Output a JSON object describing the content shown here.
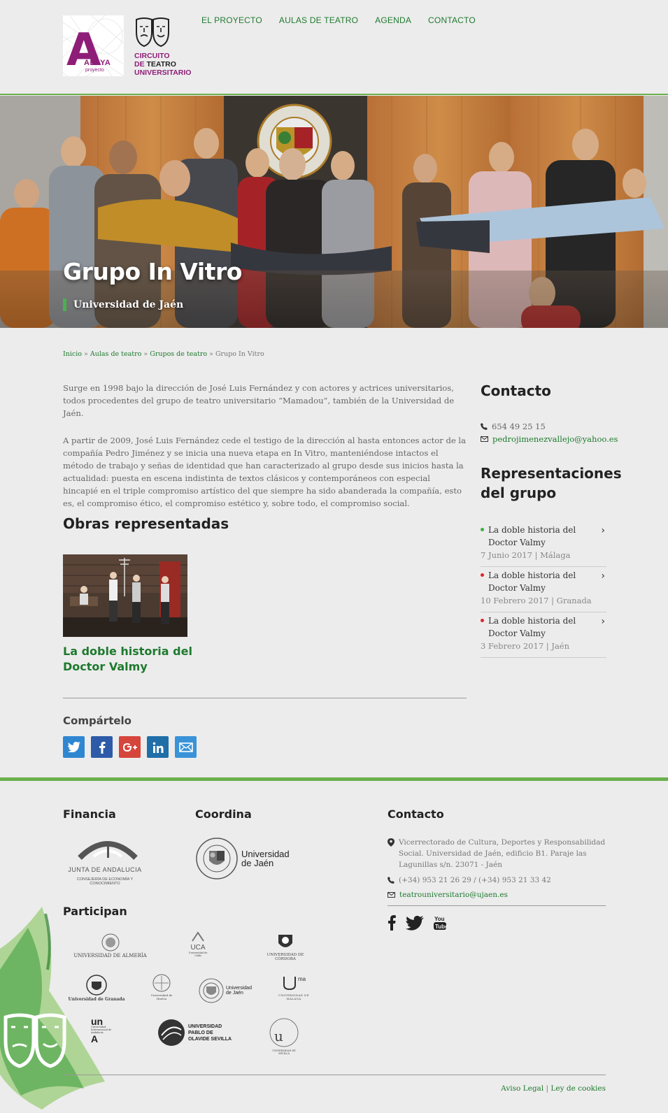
{
  "header": {
    "logo_alaya": {
      "letter": "A",
      "word": "ALAYA",
      "sub": "proyecto"
    },
    "logo_circuito": {
      "line1": "CIRCUITO",
      "line2a": "DE",
      "line2b": "TEATRO",
      "line3": "UNIVERSITARIO"
    },
    "nav": [
      {
        "label": "EL PROYECTO"
      },
      {
        "label": "AULAS DE TEATRO"
      },
      {
        "label": "AGENDA"
      },
      {
        "label": "CONTACTO"
      }
    ]
  },
  "hero": {
    "title": "Grupo In Vitro",
    "subtitle": "Universidad de Jaén"
  },
  "breadcrumb": {
    "items": [
      "Inicio",
      "Aulas de teatro",
      "Grupos de teatro"
    ],
    "separator": "»",
    "current": "Grupo In Vitro"
  },
  "main": {
    "paragraph1": "Surge en 1998 bajo la dirección de José Luis Fernández y con actores y actrices universitarios, todos procedentes del grupo de teatro universitario “Mamadou”, también de la Universidad de Jaén.",
    "paragraph2": "A partir de 2009, José Luis Fernández cede el testigo de la dirección al hasta entonces actor de la compañía Pedro Jiménez y se inicia una nueva etapa en In Vitro, manteniéndose intactos el método de trabajo y señas de identidad que han caracterizado al grupo desde sus inicios hasta la actualidad:  puesta en escena indistinta de textos clásicos y contemporáneos con especial hincapié en el triple compromiso artístico del que siempre ha sido abanderada la compañía, esto es, el compromiso ético, el compromiso estético y, sobre todo, el compromiso social.",
    "works_heading": "Obras representadas",
    "works": [
      {
        "title": "La doble historia del Doctor Valmy"
      }
    ],
    "share_heading": "Compártelo",
    "share_buttons": [
      {
        "icon": "twitter-icon",
        "color": "#2f86d1"
      },
      {
        "icon": "facebook-icon",
        "color": "#2d5ba8"
      },
      {
        "icon": "google-plus-icon",
        "color": "#d6453b"
      },
      {
        "icon": "linkedin-icon",
        "color": "#1f6ea8"
      },
      {
        "icon": "email-icon",
        "color": "#3a93d8"
      }
    ]
  },
  "sidebar": {
    "contact_heading": "Contacto",
    "phone": "654 49 25 15",
    "email": "pedrojimenezvallejo@yahoo.es",
    "representations_heading": "Representaciones del grupo",
    "events": [
      {
        "title": "La doble historia del Doctor Valmy",
        "date": "7 Junio 2017",
        "city": "Málaga",
        "dot_color": "#3cb043"
      },
      {
        "title": "La doble historia del Doctor Valmy",
        "date": "10 Febrero 2017",
        "city": "Granada",
        "dot_color": "#e0262b"
      },
      {
        "title": "La doble historia del Doctor Valmy",
        "date": "3 Febrero 2017",
        "city": "Jaén",
        "dot_color": "#e0262b"
      }
    ]
  },
  "footer": {
    "financia_heading": "Financia",
    "financia_logo": {
      "name": "JUNTA DE ANDALUCIA",
      "sub": "CONSEJERÍA DE ECONOMÍA Y CONOCIMIENTO"
    },
    "coordina_heading": "Coordina",
    "coordina_logo": {
      "line1": "Universidad",
      "line2": "de Jaén"
    },
    "participan_heading": "Participan",
    "universities": [
      "UNIVERSIDAD DE ALMERÍA",
      "UCA",
      "Universidad de Cádiz",
      "UNIVERSIDAD DE CÓRDOBA",
      "Universidad de Granada",
      "Universidad de Huelva",
      "Universidad de Jaén",
      "UNIVERSIDAD DE MÁLAGA",
      "Universidad Internacional de Andalucía",
      "UNIVERSIDAD PABLO DE OLAVIDE SEVILLA",
      "UNIVERSIDAD DE SEVILLA"
    ],
    "contact_heading": "Contacto",
    "address": "Vicerrectorado de Cultura, Deportes y Responsabilidad Social. Universidad de Jaén, edificio B1. Paraje las Lagunillas s/n. 23071 - Jaén",
    "phones": "(+34) 953 21 26 29 / (+34) 953 21 33 42",
    "email": "teatrouniversitario@ujaen.es",
    "social": [
      "facebook-icon",
      "twitter-icon",
      "youtube-icon"
    ],
    "legal": {
      "aviso": "Aviso Legal",
      "separator": "|",
      "cookies": "Ley de cookies"
    }
  }
}
